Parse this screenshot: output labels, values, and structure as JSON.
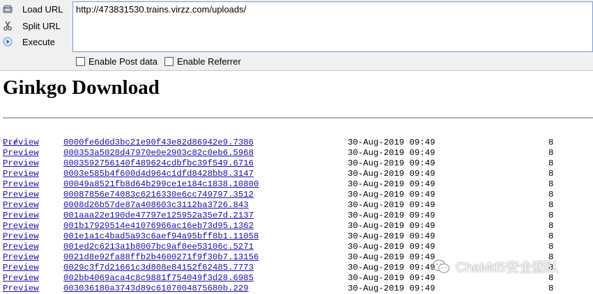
{
  "hackbar": {
    "load_url": "Load URL",
    "split_url": "Split URL",
    "execute": "Execute",
    "url_value": "http://473831530.trains.virzz.com/uploads/",
    "enable_post": "Enable Post data",
    "enable_referrer": "Enable Referrer"
  },
  "page": {
    "title": "Ginkgo Download",
    "parent_link": "../",
    "preview_label": "Preview",
    "rows": [
      {
        "name": "0000fe6d6d3bc21e90f43e82d86942e9.7386",
        "date": "30-Aug-2019 09:49",
        "size": "8"
      },
      {
        "name": "000353a5028d47970e0e2903c82c0eb6.5968",
        "date": "30-Aug-2019 09:49",
        "size": "8"
      },
      {
        "name": "0003592756140f489624cdbfbc39f549.6716",
        "date": "30-Aug-2019 09:49",
        "size": "8"
      },
      {
        "name": "0003e585b4f600d4d964c1dfd8428bb8.3147",
        "date": "30-Aug-2019 09:49",
        "size": "8"
      },
      {
        "name": "00049a8521fb8d64b299ce1e184c1838.10800",
        "date": "30-Aug-2019 09:49",
        "size": "8"
      },
      {
        "name": "00087856e74083c6216330e6cc749797.3512",
        "date": "30-Aug-2019 09:49",
        "size": "8"
      },
      {
        "name": "0008d26b57de87a408603c3112ba3726.843",
        "date": "30-Aug-2019 09:49",
        "size": "8"
      },
      {
        "name": "001aaa22e190de47797e125952a35e7d.2137",
        "date": "30-Aug-2019 09:49",
        "size": "8"
      },
      {
        "name": "001b17929514e41076966ac16eb73d95.1362",
        "date": "30-Aug-2019 09:49",
        "size": "8"
      },
      {
        "name": "001e1a1c4bad5a93c6aef94a95bff8b1.11058",
        "date": "30-Aug-2019 09:49",
        "size": "8"
      },
      {
        "name": "001ed2c6213a1b8007bc9af8ee53106c.5271",
        "date": "30-Aug-2019 09:49",
        "size": "8"
      },
      {
        "name": "0021d8e92fa88ffb2b4600271f9f30b7.13156",
        "date": "30-Aug-2019 09:49",
        "size": "8"
      },
      {
        "name": "0029c3f7d21661c3d808e84152f62485.7773",
        "date": "30-Aug-2019 09:49",
        "size": "8"
      },
      {
        "name": "002bb4069aca4c8c9881f754049f3d28.6985",
        "date": "30-Aug-2019 09:49",
        "size": "8"
      },
      {
        "name": "003036180a3743d89c6107004875680b.229",
        "date": "30-Aug-2019 09:49",
        "size": "8"
      }
    ]
  },
  "watermark": {
    "text": "ChaMd5安全团队"
  },
  "icons": {
    "load": "load-url-icon",
    "split": "split-url-icon",
    "execute": "execute-icon",
    "watermark": "wechat-icon"
  }
}
